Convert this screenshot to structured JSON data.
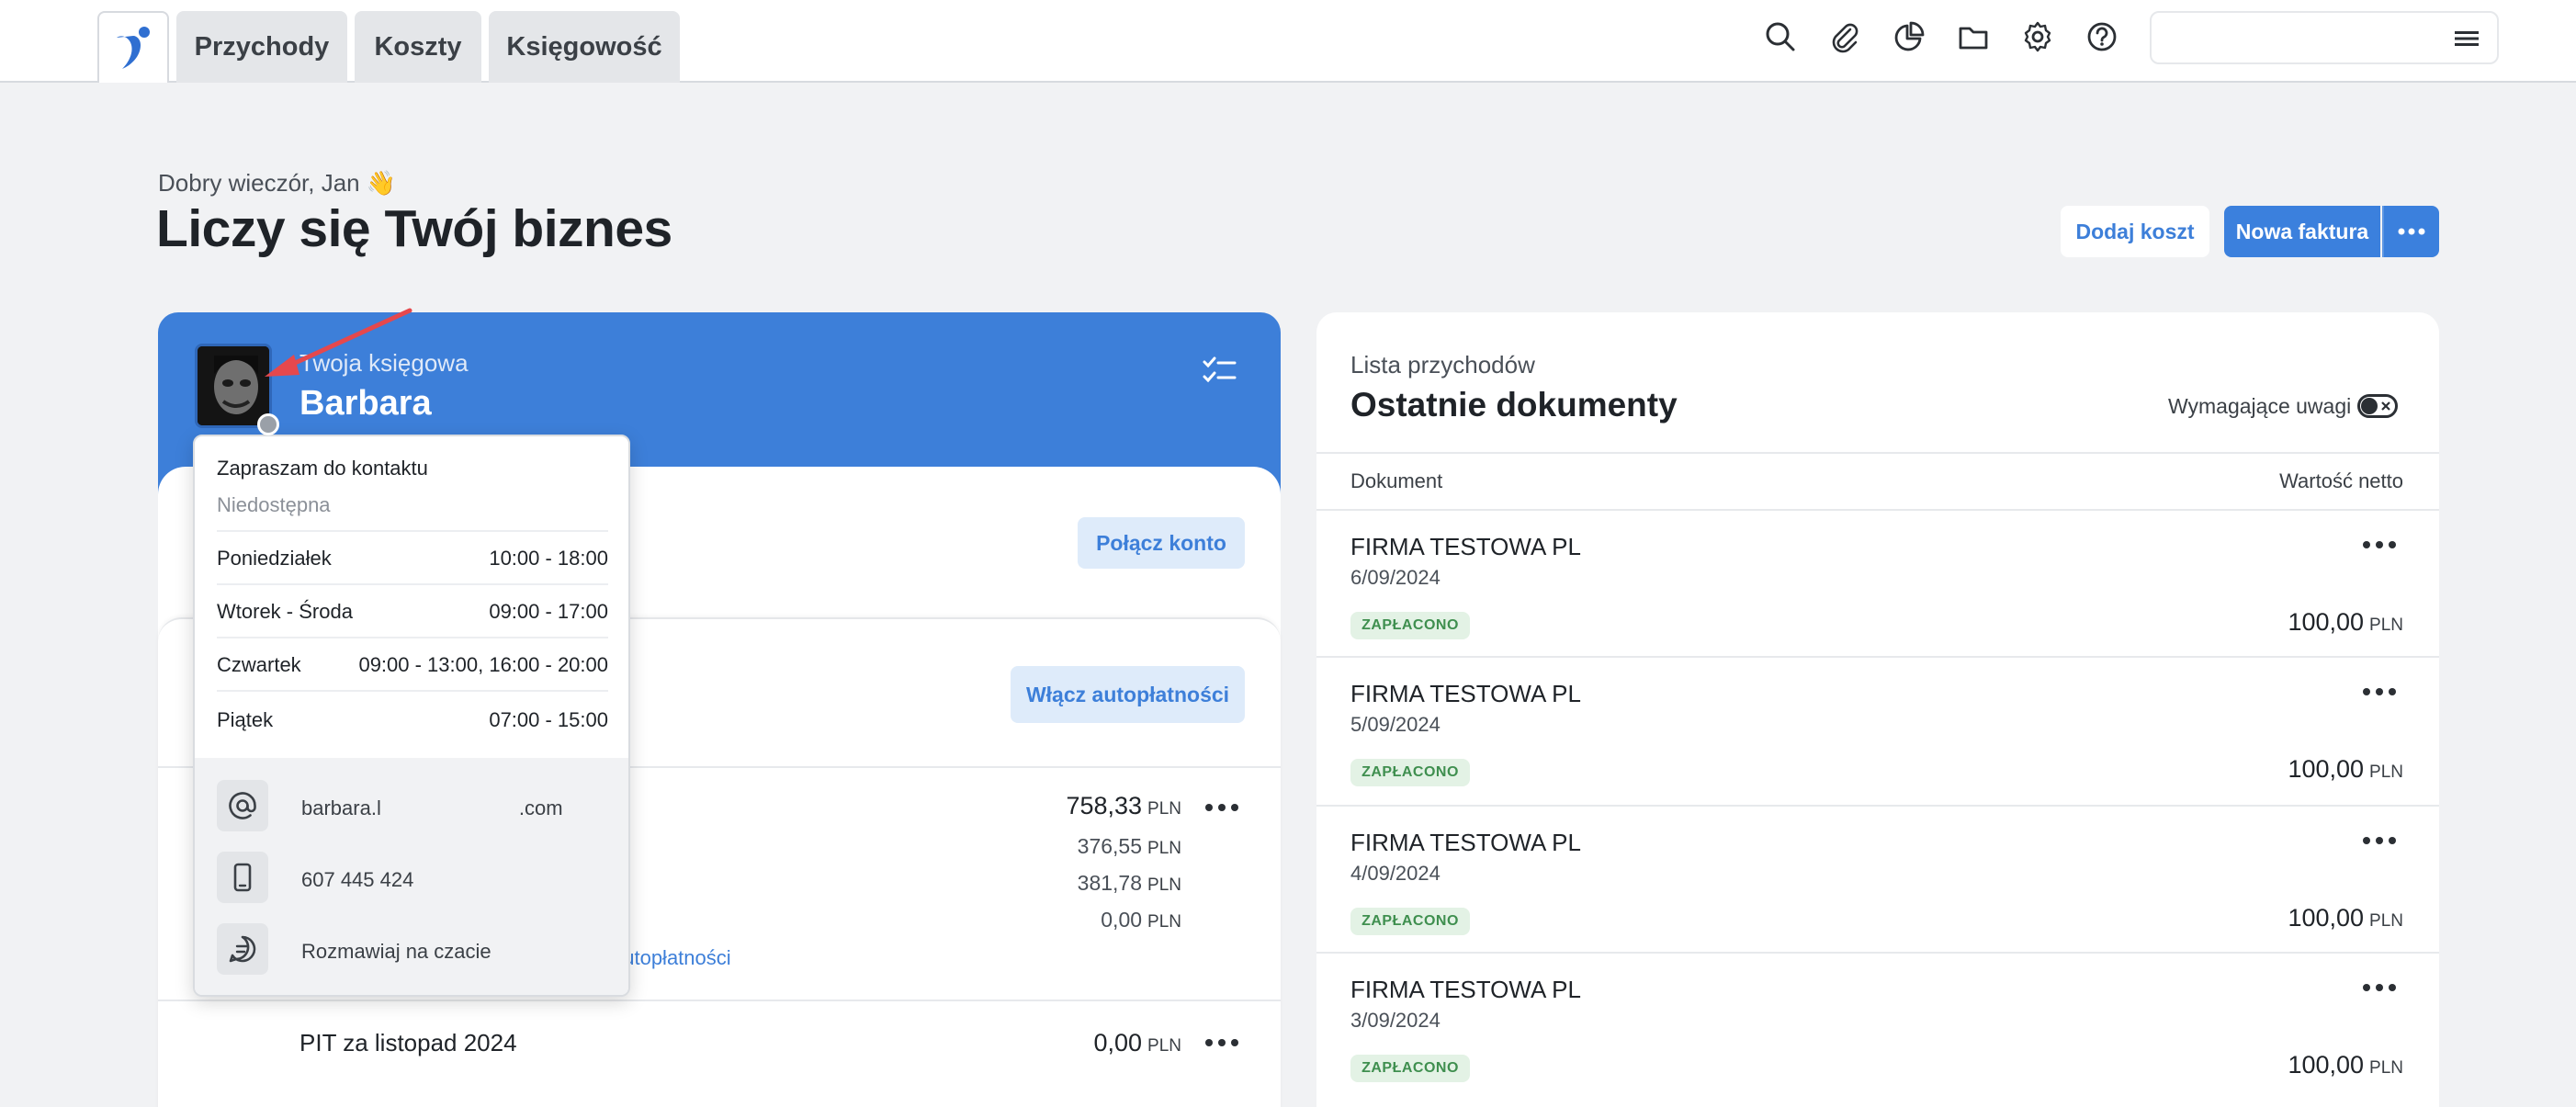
{
  "nav": {
    "tabs": [
      "Przychody",
      "Koszty",
      "Księgowość"
    ],
    "icons": [
      "search-icon",
      "paperclip-icon",
      "pie-chart-icon",
      "folder-icon",
      "gear-icon",
      "help-icon"
    ],
    "search_placeholder": ""
  },
  "header": {
    "greeting": "Dobry wieczór, Jan 👋",
    "title": "Liczy się Twój biznes",
    "btn_dodaj": "Dodaj koszt",
    "btn_nowa": "Nowa faktura"
  },
  "accountant": {
    "label": "Twoja księgowa",
    "name": "Barbara",
    "btn_polacz": "Połącz konto",
    "btn_autopl": "Włącz autopłatności",
    "amount_main": "758,33",
    "amounts_sub": [
      "376,55",
      "381,78",
      "0,00"
    ],
    "currency": "PLN",
    "link_autopl": "autopłatności",
    "pit_label": "PIT za listopad 2024",
    "pit_amount": "0,00"
  },
  "popup": {
    "contact_invite": "Zapraszam do kontaktu",
    "status": "Niedostępna",
    "schedule": [
      {
        "day": "Poniedziałek",
        "hours": "10:00 - 18:00"
      },
      {
        "day": "Wtorek - Środa",
        "hours": "09:00 - 17:00"
      },
      {
        "day": "Czwartek",
        "hours": "09:00 - 13:00, 16:00 - 20:00"
      },
      {
        "day": "Piątek",
        "hours": "07:00 - 15:00"
      }
    ],
    "email_start": "barbara.l",
    "email_end": ".com",
    "phone": "607 445 424",
    "chat": "Rozmawiaj na czacie"
  },
  "documents": {
    "label": "Lista przychodów",
    "title": "Ostatnie dokumenty",
    "attention_label": "Wymagające uwagi",
    "col_doc": "Dokument",
    "col_value": "Wartość netto",
    "rows": [
      {
        "name": "FIRMA TESTOWA PL",
        "date": "6/09/2024",
        "status": "ZAPŁACONO",
        "amount": "100,00",
        "currency": "PLN"
      },
      {
        "name": "FIRMA TESTOWA PL",
        "date": "5/09/2024",
        "status": "ZAPŁACONO",
        "amount": "100,00",
        "currency": "PLN"
      },
      {
        "name": "FIRMA TESTOWA PL",
        "date": "4/09/2024",
        "status": "ZAPŁACONO",
        "amount": "100,00",
        "currency": "PLN"
      },
      {
        "name": "FIRMA TESTOWA PL",
        "date": "3/09/2024",
        "status": "ZAPŁACONO",
        "amount": "100,00",
        "currency": "PLN"
      }
    ]
  },
  "colors": {
    "accent": "#3d7fd9",
    "paid_badge_bg": "#e3f2e5",
    "paid_badge_text": "#3f8f4f",
    "annotation_arrow": "#e5484d"
  }
}
